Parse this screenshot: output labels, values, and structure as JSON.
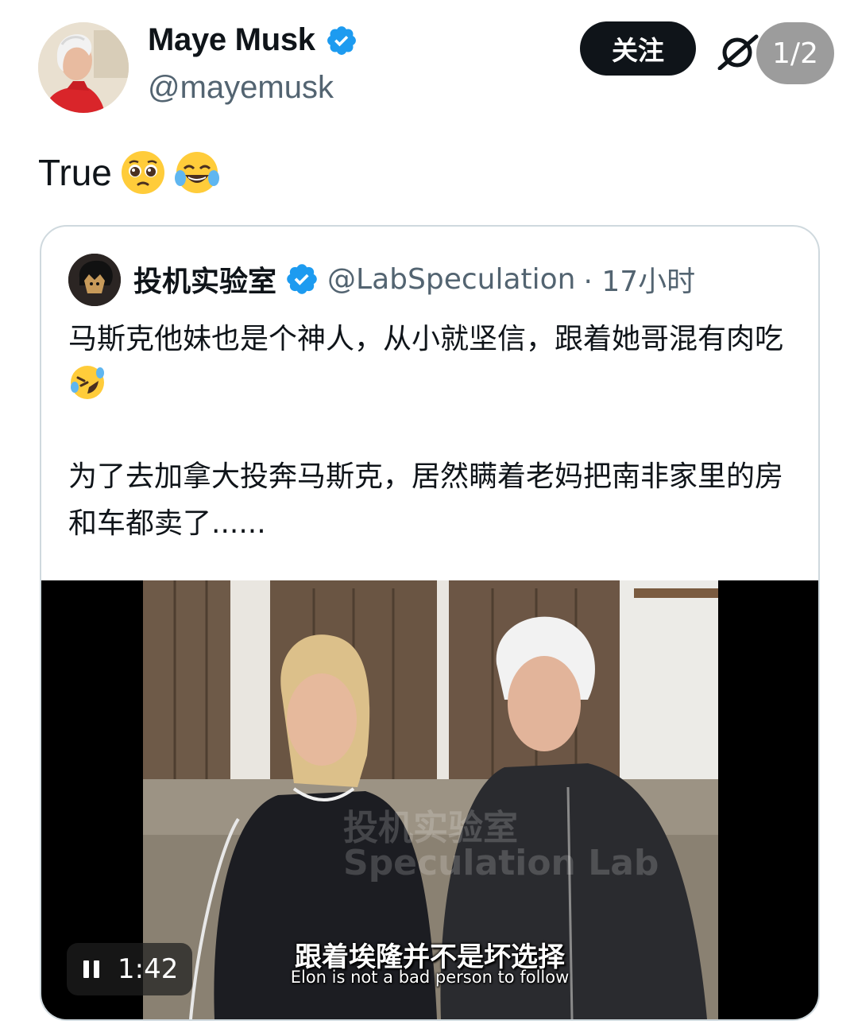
{
  "tweet": {
    "author_name": "Maye Musk",
    "author_handle": "@mayemusk",
    "follow_label": "关注",
    "text": "True",
    "emojis": [
      "pleading-face-icon",
      "tears-of-joy-icon"
    ]
  },
  "viewer": {
    "page_indicator": "1/2"
  },
  "quoted_tweet": {
    "author_name": "投机实验室",
    "author_handle": "@LabSpeculation",
    "time": "· 17小时",
    "paragraph1": "马斯克他妹也是个神人，从小就坚信，跟着她哥混有肉吃",
    "paragraph2": "为了去加拿大投奔马斯克，居然瞒着老妈把南非家里的房和车都卖了......",
    "video": {
      "duration": "1:42",
      "subtitle_zh": "跟着埃隆并不是坏选择",
      "subtitle_en": "Elon is not a bad person to follow"
    }
  },
  "colors": {
    "verified_blue": "#1d9bf0",
    "text_primary": "#0f1419",
    "text_secondary": "#536471",
    "border": "#cfd9de"
  }
}
